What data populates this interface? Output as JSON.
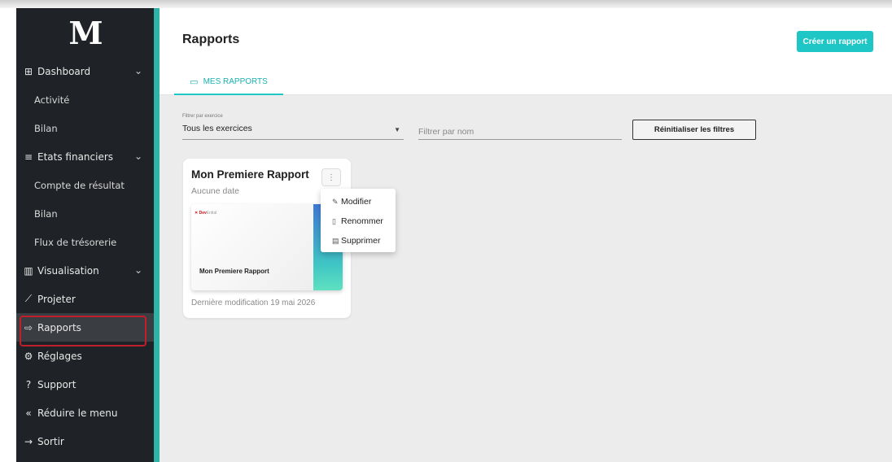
{
  "app": {
    "logo": "M"
  },
  "sidebar": {
    "items": [
      {
        "icon": "grid-icon",
        "glyph": "⊞",
        "label": "Dashboard",
        "chevron": true
      },
      {
        "label": "Activité",
        "sub": true
      },
      {
        "label": "Bilan",
        "sub": true
      },
      {
        "icon": "menu-lines-icon",
        "glyph": "≡",
        "label": "Etats financiers",
        "chevron": true
      },
      {
        "label": "Compte de résultat",
        "sub": true
      },
      {
        "label": "Bilan",
        "sub": true
      },
      {
        "label": "Flux de trésorerie",
        "sub": true
      },
      {
        "icon": "bar-chart-icon",
        "glyph": "▥",
        "label": "Visualisation",
        "chevron": true
      },
      {
        "icon": "line-chart-icon",
        "glyph": "⟋",
        "label": "Projeter"
      },
      {
        "icon": "export-icon",
        "glyph": "⇨",
        "label": "Rapports",
        "active": true
      },
      {
        "icon": "gear-icon",
        "glyph": "⚙",
        "label": "Réglages"
      },
      {
        "icon": "help-icon",
        "glyph": "?",
        "label": "Support"
      },
      {
        "icon": "double-chevron-left-icon",
        "glyph": "«",
        "label": "Réduire le menu"
      },
      {
        "icon": "logout-icon",
        "glyph": "→",
        "label": "Sortir"
      }
    ]
  },
  "header": {
    "title": "Rapports",
    "create_label": "Créer un rapport",
    "tab_label": "MES RAPPORTS"
  },
  "filters": {
    "exercise_label": "Filtrer par exercice",
    "exercise_value": "Tous les exercices",
    "name_placeholder": "Filtrer par nom",
    "reset_label": "Réinitialiser les filtres"
  },
  "card": {
    "title": "Mon Premiere Rapport",
    "date": "Aucune date",
    "thumb_brand": "Dev",
    "thumb_brand_rest": "Ential",
    "thumb_title": "Mon Premiere Rapport",
    "footer": "Dernière modification 19 mai 2026"
  },
  "menu": {
    "items": [
      {
        "icon": "pencil-icon",
        "glyph": "✎",
        "label": "Modifier"
      },
      {
        "icon": "file-rename-icon",
        "glyph": "▯",
        "label": "Renommer"
      },
      {
        "icon": "trash-icon",
        "glyph": "▤",
        "label": "Supprimer"
      }
    ]
  },
  "colors": {
    "accent": "#1ec6c6",
    "sidebar_bg": "#1f2226",
    "highlight": "#c21d2a"
  }
}
